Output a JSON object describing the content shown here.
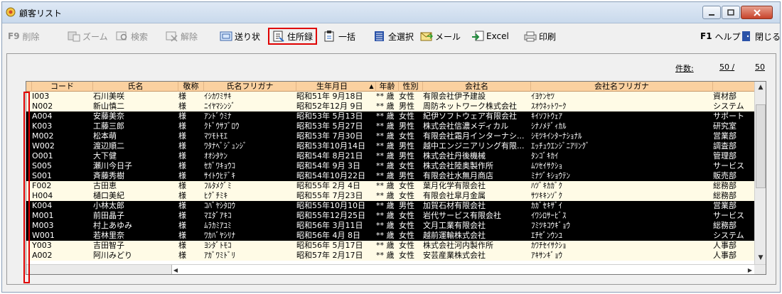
{
  "window": {
    "title": "顧客リスト"
  },
  "toolbar": {
    "delete_key": "F9",
    "delete": "削除",
    "zoom": "ズーム",
    "search": "検索",
    "clear": "解除",
    "send": "送り状",
    "address": "住所録",
    "bulk": "一括",
    "select_all": "全選択",
    "mail": "メール",
    "excel": "Excel",
    "print": "印刷",
    "help_key": "F1",
    "help": "ヘルプ",
    "close": "閉じる"
  },
  "count": {
    "label": "件数:",
    "value": "50 /",
    "total": "50"
  },
  "columns": [
    "コード",
    "氏名",
    "敬称",
    "氏名フリガナ",
    "生年月日",
    "年齢",
    "性別",
    "会社名",
    "会社名フリガナ",
    ""
  ],
  "sort_indicator": "▲",
  "rows": [
    {
      "style": "light",
      "code": "I003",
      "name": "石川美咲",
      "hon": "様",
      "kana": "ｲｼｶﾜﾐｻｷ",
      "birth": "昭和51年 9月18日",
      "age": "** 歳",
      "sex": "女性",
      "company": "有限会社伊予建設",
      "ckana": "ｲﾖｹﾝｾﾂ",
      "dept": "資材部"
    },
    {
      "style": "light",
      "code": "N002",
      "name": "新山慎二",
      "hon": "様",
      "kana": "ﾆｲﾔﾏｼﾝｼﾞ",
      "birth": "昭和52年12月 9日",
      "age": "** 歳",
      "sex": "男性",
      "company": "周防ネットワーク株式会社",
      "ckana": "ｽｵｳﾈｯﾄﾜｰｸ",
      "dept": "システム"
    },
    {
      "style": "dark",
      "code": "A004",
      "name": "安藤美奈",
      "hon": "様",
      "kana": "ｱﾝﾄﾞｳﾐﾅ",
      "birth": "昭和53年 5月13日",
      "age": "** 歳",
      "sex": "女性",
      "company": "紀伊ソフトウェア有限会社",
      "ckana": "ｷｲｿﾌﾄｳｪｱ",
      "dept": "サポート"
    },
    {
      "style": "dark",
      "code": "K003",
      "name": "工藤三郎",
      "hon": "様",
      "kana": "ｸﾄﾞｳｻﾌﾞﾛｳ",
      "birth": "昭和53年 5月27日",
      "age": "** 歳",
      "sex": "男性",
      "company": "株式会社信濃メディカル",
      "ckana": "ｼﾅﾉﾒﾃﾞｨｶﾙ",
      "dept": "研究室"
    },
    {
      "style": "dark",
      "code": "M002",
      "name": "松本萌",
      "hon": "様",
      "kana": "ﾏﾂﾓﾄﾓｴ",
      "birth": "昭和53年 7月30日",
      "age": "** 歳",
      "sex": "女性",
      "company": "有限会社霜月インターナシ...",
      "ckana": "ｼﾓﾂｷｲﾝﾀｰﾅｼｮﾅﾙ",
      "dept": "営業部"
    },
    {
      "style": "dark",
      "code": "W002",
      "name": "渡辺順二",
      "hon": "様",
      "kana": "ﾜﾀﾅﾍﾞｼﾞｭﾝｼﾞ",
      "birth": "昭和53年10月14日",
      "age": "** 歳",
      "sex": "男性",
      "company": "越中エンジニアリング有限...",
      "ckana": "ｴｯﾁｭｳｴﾝｼﾞﾆｱﾘﾝｸﾞ",
      "dept": "調査部"
    },
    {
      "style": "dark",
      "code": "O001",
      "name": "大下健",
      "hon": "様",
      "kana": "ｵｵｼﾀｹﾝ",
      "birth": "昭和54年 8月21日",
      "age": "** 歳",
      "sex": "男性",
      "company": "株式会社丹後機械",
      "ckana": "ﾀﾝｺﾞｷｶｲ",
      "dept": "管理部"
    },
    {
      "style": "dark",
      "code": "S005",
      "name": "瀬川今日子",
      "hon": "様",
      "kana": "ｾｶﾞﾜｷｮｳｺ",
      "birth": "昭和54年 9月 3日",
      "age": "** 歳",
      "sex": "女性",
      "company": "株式会社陸奥製作所",
      "ckana": "ﾑﾂｾｲｻｸｼｮ",
      "dept": "サービス"
    },
    {
      "style": "dark",
      "code": "S001",
      "name": "斉藤秀樹",
      "hon": "様",
      "kana": "ｻｲﾄｳﾋﾃﾞｷ",
      "birth": "昭和54年10月22日",
      "age": "** 歳",
      "sex": "男性",
      "company": "有限会社水無月商店",
      "ckana": "ﾐﾅﾂﾞｷｼｮｳﾃﾝ",
      "dept": "販売部"
    },
    {
      "style": "light",
      "code": "F002",
      "name": "古田恵",
      "hon": "様",
      "kana": "ﾌﾙﾀﾒｸﾞﾐ",
      "birth": "昭和55年 2月 4日",
      "age": "** 歳",
      "sex": "女性",
      "company": "葉月化学有限会社",
      "ckana": "ﾊﾂﾞｷｶｶﾞｸ",
      "dept": "総務部"
    },
    {
      "style": "light",
      "code": "H004",
      "name": "樋口美紀",
      "hon": "様",
      "kana": "ﾋｸﾞﾁﾐｷ",
      "birth": "昭和55年 7月23日",
      "age": "** 歳",
      "sex": "女性",
      "company": "有限会社皐月金属",
      "ckana": "ｻﾂｷｷﾝｿﾞｸ",
      "dept": "総務部"
    },
    {
      "style": "dark",
      "code": "K004",
      "name": "小林太郎",
      "hon": "様",
      "kana": "ｺﾊﾞﾔｼﾀﾛｳ",
      "birth": "昭和55年10月10日",
      "age": "** 歳",
      "sex": "男性",
      "company": "加賀石材有限会社",
      "ckana": "ｶｶﾞｾｷｻﾞｲ",
      "dept": "営業部"
    },
    {
      "style": "dark",
      "code": "M001",
      "name": "前田晶子",
      "hon": "様",
      "kana": "ﾏｴﾀﾞｱｷｺ",
      "birth": "昭和55年12月25日",
      "age": "** 歳",
      "sex": "女性",
      "company": "岩代サービス有限会社",
      "ckana": "ｲﾜｼﾛｻｰﾋﾞｽ",
      "dept": "サービス"
    },
    {
      "style": "dark",
      "code": "M003",
      "name": "村上あゆみ",
      "hon": "様",
      "kana": "ﾑﾗｶﾐｱﾕﾐ",
      "birth": "昭和56年 3月11日",
      "age": "** 歳",
      "sex": "女性",
      "company": "文月工業有限会社",
      "ckana": "ﾌﾐﾂｷｺｳｷﾞｮｳ",
      "dept": "総務部"
    },
    {
      "style": "dark",
      "code": "W001",
      "name": "若林里奈",
      "hon": "様",
      "kana": "ﾜｶﾊﾞﾔｼﾘﾅ",
      "birth": "昭和56年 4月 8日",
      "age": "** 歳",
      "sex": "女性",
      "company": "越前運輸株式会社",
      "ckana": "ｴﾁｾﾞﾝｳﾝﾕ",
      "dept": "システム"
    },
    {
      "style": "light",
      "code": "Y003",
      "name": "吉田智子",
      "hon": "様",
      "kana": "ﾖｼﾀﾞﾄﾓｺ",
      "birth": "昭和56年 5月17日",
      "age": "** 歳",
      "sex": "女性",
      "company": "株式会社河内製作所",
      "ckana": "ｶﾜﾁｾｲｻｸｼｮ",
      "dept": "人事部"
    },
    {
      "style": "light",
      "code": "A002",
      "name": "阿川みどり",
      "hon": "様",
      "kana": "ｱｶﾞﾜﾐﾄﾞﾘ",
      "birth": "昭和57年 2月17日",
      "age": "** 歳",
      "sex": "女性",
      "company": "安芸産業株式会社",
      "ckana": "ｱｷｻﾝｷﾞｮｳ",
      "dept": "人事部"
    }
  ]
}
